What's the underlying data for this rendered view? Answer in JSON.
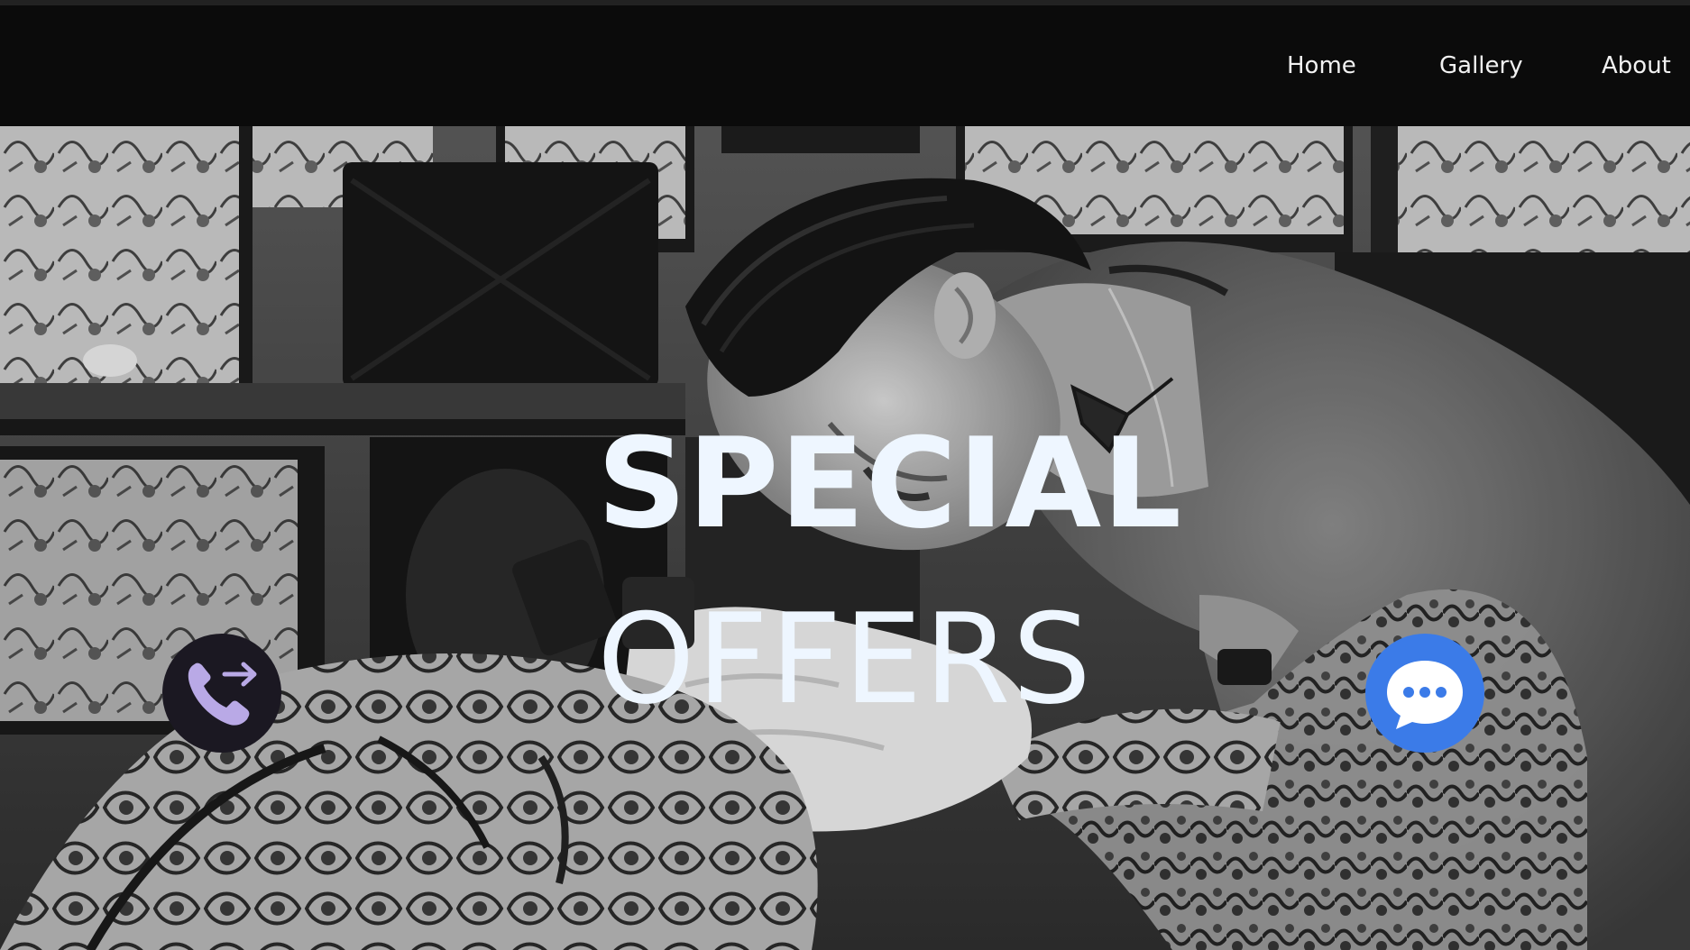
{
  "nav": {
    "items": [
      {
        "label": "Home"
      },
      {
        "label": "Gallery"
      },
      {
        "label": "About"
      }
    ]
  },
  "hero": {
    "title_line1": "SPECIAL",
    "title_line2": "OFFERS",
    "image": "tattoo-artist-photo"
  },
  "floating_actions": {
    "call": {
      "icon": "phone-forward-icon",
      "color": "#1b1822",
      "icon_color": "#b9a9e6"
    },
    "chat": {
      "icon": "chat-bubble-icon",
      "color": "#3b7be8",
      "icon_color": "#ffffff"
    }
  },
  "colors": {
    "nav_background": "#0b0b0b",
    "nav_text": "#f2f2f2",
    "title_text": "#eef6ff"
  }
}
